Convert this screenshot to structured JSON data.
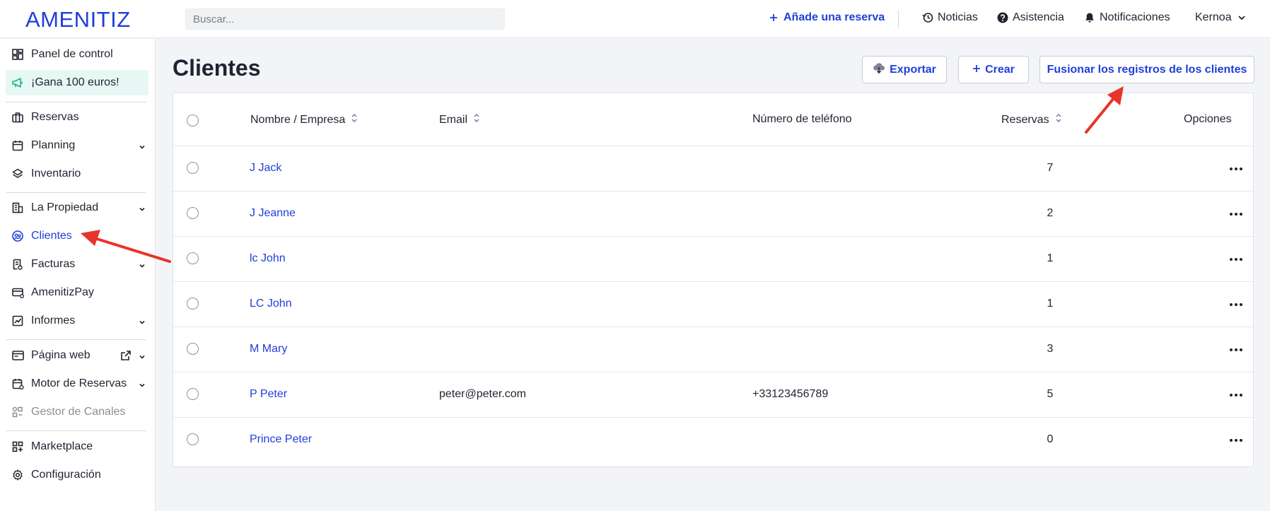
{
  "app": {
    "logo": "AMENITIZ"
  },
  "search": {
    "placeholder": "Buscar..."
  },
  "topnav": {
    "add_booking": "Añade una reserva",
    "news": "Noticias",
    "help": "Asistencia",
    "notifications": "Notificaciones",
    "user": "Kernoa"
  },
  "sidebar": {
    "items": [
      {
        "label": "Panel de control",
        "icon": "dashboard-icon"
      },
      {
        "label": "¡Gana 100 euros!",
        "icon": "megaphone-icon"
      },
      {
        "label": "Reservas",
        "icon": "suitcase-icon"
      },
      {
        "label": "Planning",
        "icon": "calendar-icon"
      },
      {
        "label": "Inventario",
        "icon": "layers-icon"
      },
      {
        "label": "La Propiedad",
        "icon": "building-icon"
      },
      {
        "label": "Clientes",
        "icon": "clients-icon"
      },
      {
        "label": "Facturas",
        "icon": "invoice-icon"
      },
      {
        "label": "AmenitizPay",
        "icon": "card-icon"
      },
      {
        "label": "Informes",
        "icon": "chart-icon"
      },
      {
        "label": "Página web",
        "icon": "browser-icon"
      },
      {
        "label": "Motor de Reservas",
        "icon": "booking-engine-icon"
      },
      {
        "label": "Gestor de Canales",
        "icon": "channels-icon"
      },
      {
        "label": "Marketplace",
        "icon": "marketplace-icon"
      },
      {
        "label": "Configuración",
        "icon": "gear-icon"
      }
    ]
  },
  "main": {
    "title": "Clientes",
    "export_label": "Exportar",
    "create_label": "Crear",
    "merge_label": "Fusionar los registros de los clientes"
  },
  "table": {
    "columns": {
      "name": "Nombre / Empresa",
      "email": "Email",
      "phone": "Número de teléfono",
      "bookings": "Reservas",
      "options": "Opciones"
    },
    "rows": [
      {
        "name": "J Jack",
        "email": "",
        "phone": "",
        "bookings": "7"
      },
      {
        "name": "J Jeanne",
        "email": "",
        "phone": "",
        "bookings": "2"
      },
      {
        "name": "lc John",
        "email": "",
        "phone": "",
        "bookings": "1"
      },
      {
        "name": "LC John",
        "email": "",
        "phone": "",
        "bookings": "1"
      },
      {
        "name": "M Mary",
        "email": "",
        "phone": "",
        "bookings": "3"
      },
      {
        "name": "P Peter",
        "email": "peter@peter.com",
        "phone": "+33123456789",
        "bookings": "5"
      },
      {
        "name": "Prince Peter",
        "email": "",
        "phone": "",
        "bookings": "0"
      }
    ]
  },
  "colors": {
    "brand": "#1f3fd8",
    "annotation_arrow": "#e8342a",
    "promo_bg": "#e7f7f3"
  }
}
